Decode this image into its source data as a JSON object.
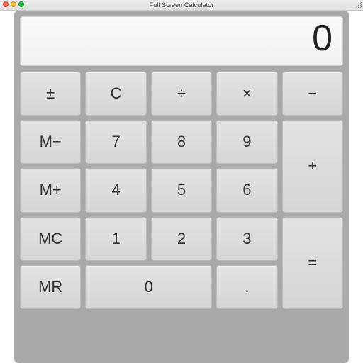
{
  "window": {
    "title": "Full Screen Calculator"
  },
  "display": {
    "value": "0"
  },
  "keys": {
    "plus_minus": "±",
    "clear": "C",
    "divide": "÷",
    "multiply": "×",
    "minus": "−",
    "m_minus": "M−",
    "seven": "7",
    "eight": "8",
    "nine": "9",
    "plus": "+",
    "m_plus": "M+",
    "four": "4",
    "five": "5",
    "six": "6",
    "mc": "MC",
    "one": "1",
    "two": "2",
    "three": "3",
    "equals": "=",
    "mr": "MR",
    "zero": "0",
    "decimal": "."
  }
}
